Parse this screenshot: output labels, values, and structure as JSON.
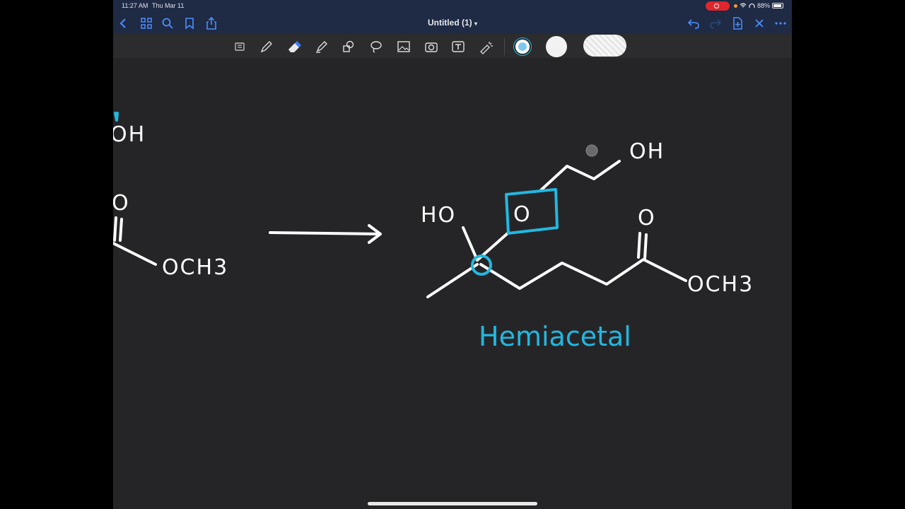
{
  "status_bar": {
    "time": "11:27 AM",
    "date": "Thu Mar 11",
    "battery": "88%"
  },
  "nav": {
    "title": "Untitled (1)"
  },
  "toolbar": {
    "tools": [
      "page-icon",
      "pen-icon",
      "eraser-icon",
      "highlighter-icon",
      "shapes-icon",
      "lasso-icon",
      "image-icon",
      "camera-icon",
      "text-icon",
      "laser-pointer-icon"
    ],
    "colors": {
      "selected": "#22b8e0",
      "white": "#ffffff",
      "ink": "#ffffff",
      "accent": "#22b8e0"
    }
  },
  "canvas": {
    "left_molecule": {
      "top_label": "OH",
      "substituent": "OCH3",
      "carbonyl": "O"
    },
    "right_molecule": {
      "ho_label": "HO",
      "oh_label": "OH",
      "ring_oxygen": "O",
      "carbonyl": "O",
      "ester": "OCH3"
    },
    "annotation": "Hemiacetal"
  }
}
